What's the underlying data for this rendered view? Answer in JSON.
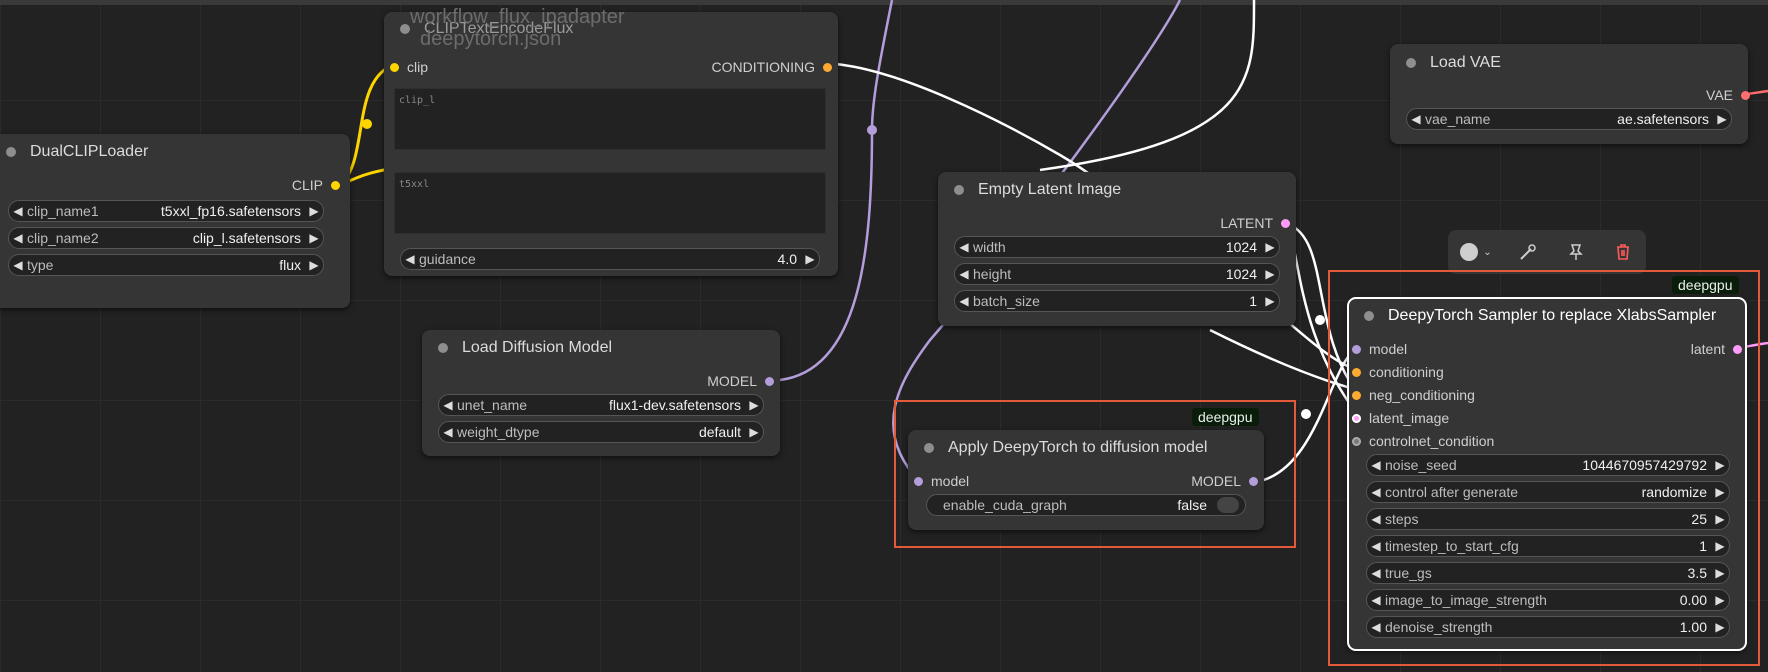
{
  "canvas": {
    "ghost_title_line1": "workflow_flux_ipadapter",
    "ghost_title_line2": "deepytorch.json"
  },
  "colors": {
    "clip": "#ffd500",
    "conditioning": "#ffa931",
    "model": "#b39ddb",
    "latent": "#ff9cf9",
    "vae": "#ff6e6e",
    "wire_white": "#ffffff",
    "highlight": "#e35a3b",
    "badge_bg": "#0a1d0a"
  },
  "nodes": {
    "dual_clip": {
      "title": "DualCLIPLoader",
      "out_clip": "CLIP",
      "clip_name1_label": "clip_name1",
      "clip_name1_value": "t5xxl_fp16.safetensors",
      "clip_name2_label": "clip_name2",
      "clip_name2_value": "clip_l.safetensors",
      "type_label": "type",
      "type_value": "flux"
    },
    "clip_text": {
      "title": "CLIPTextEncodeFlux",
      "in_clip": "clip",
      "out_conditioning": "CONDITIONING",
      "clip_l_placeholder": "clip_l",
      "t5xxl_placeholder": "t5xxl",
      "guidance_label": "guidance",
      "guidance_value": "4.0"
    },
    "load_diffusion": {
      "title": "Load Diffusion Model",
      "out_model": "MODEL",
      "unet_name_label": "unet_name",
      "unet_name_value": "flux1-dev.safetensors",
      "weight_dtype_label": "weight_dtype",
      "weight_dtype_value": "default"
    },
    "empty_latent": {
      "title": "Empty Latent Image",
      "out_latent": "LATENT",
      "width_label": "width",
      "width_value": "1024",
      "height_label": "height",
      "height_value": "1024",
      "batch_label": "batch_size",
      "batch_value": "1"
    },
    "load_vae": {
      "title": "Load VAE",
      "out_vae": "VAE",
      "vae_name_label": "vae_name",
      "vae_name_value": "ae.safetensors"
    },
    "apply_deepy": {
      "badge": "deepgpu",
      "title": "Apply DeepyTorch to diffusion model",
      "in_model": "model",
      "out_model": "MODEL",
      "cuda_label": "enable_cuda_graph",
      "cuda_value": "false"
    },
    "sampler": {
      "badge": "deepgpu",
      "title": "DeepyTorch Sampler to replace XlabsSampler",
      "in_model": "model",
      "in_conditioning": "conditioning",
      "in_neg": "neg_conditioning",
      "in_latent": "latent_image",
      "in_controlnet": "controlnet_condition",
      "out_latent": "latent",
      "widgets": [
        {
          "label": "noise_seed",
          "value": "1044670957429792"
        },
        {
          "label": "control after generate",
          "value": "randomize"
        },
        {
          "label": "steps",
          "value": "25"
        },
        {
          "label": "timestep_to_start_cfg",
          "value": "1"
        },
        {
          "label": "true_gs",
          "value": "3.5"
        },
        {
          "label": "image_to_image_strength",
          "value": "0.00"
        },
        {
          "label": "denoise_strength",
          "value": "1.00"
        }
      ]
    }
  }
}
